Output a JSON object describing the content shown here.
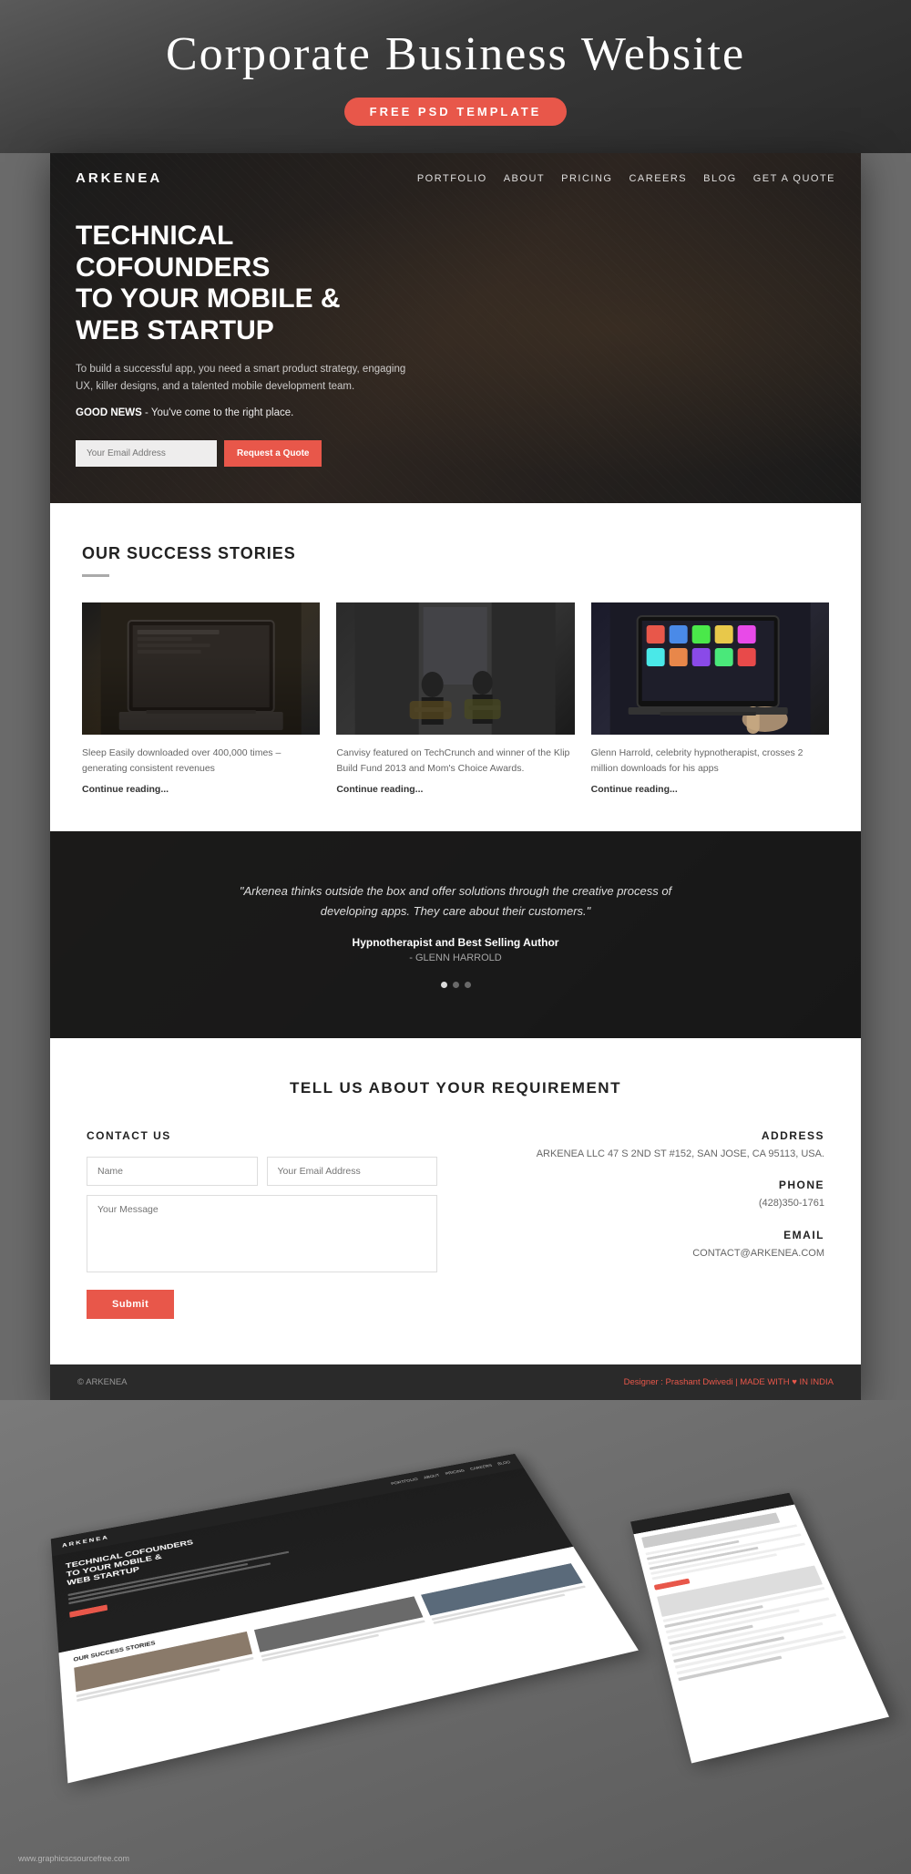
{
  "header": {
    "title": "Corporate Business Website",
    "badge": "FREE PSD TEMPLATE"
  },
  "hero": {
    "logo": "ARKENEA",
    "nav": [
      "PORTFOLIO",
      "ABOUT",
      "PRICING",
      "CAREERS",
      "BLOG",
      "GET A QUOTE"
    ],
    "headline_line1": "TECHNICAL COFOUNDERS",
    "headline_line2": "TO YOUR MOBILE &",
    "headline_line3": "WEB STARTUP",
    "body_text": "To build a successful app, you need a smart product strategy, engaging UX, killer designs, and a talented mobile development team.",
    "good_news": "GOOD NEWS",
    "good_news_suffix": " - You've come to the right place.",
    "email_placeholder": "Your Email Address",
    "cta_button": "Request a Quote"
  },
  "success": {
    "heading": "OUR SUCCESS STORIES",
    "stories": [
      {
        "description": "Sleep Easily downloaded over 400,000 times – generating consistent revenues",
        "link": "Continue reading..."
      },
      {
        "description": "Canvisy featured on TechCrunch and winner of the Klip Build Fund 2013 and Mom's Choice Awards.",
        "link": "Continue reading..."
      },
      {
        "description": "Glenn Harrold, celebrity hypnotherapist, crosses 2 million downloads for his apps",
        "link": "Continue reading..."
      }
    ]
  },
  "testimonial": {
    "quote": "\"Arkenea thinks outside the box and offer solutions through the creative process of developing apps. They care about their customers.\"",
    "author": "Hypnotherapist and Best Selling Author",
    "name": "- GLENN HARROLD",
    "dots": [
      true,
      false,
      false
    ]
  },
  "contact": {
    "heading": "TELL US ABOUT YOUR REQUIREMENT",
    "form_heading": "CONTACT US",
    "name_placeholder": "Name",
    "email_placeholder": "Your Email Address",
    "message_placeholder": "Your Message",
    "submit_label": "Submit",
    "address_label": "ADDRESS",
    "address_value": "ARKENEA LLC 47 S 2ND ST #152, SAN JOSE, CA 95113, USA.",
    "phone_label": "PHONE",
    "phone_value": "(428)350-1761",
    "email_label": "EMAIL",
    "email_value": "CONTACT@ARKENEA.COM"
  },
  "footer": {
    "left": "© ARKENEA",
    "right_prefix": "Designer : Prashant Dwivedi | MADE WITH",
    "heart": "♥",
    "right_suffix": "IN INDIA"
  },
  "bottom_url": "www.graphicscsourcefree.com"
}
